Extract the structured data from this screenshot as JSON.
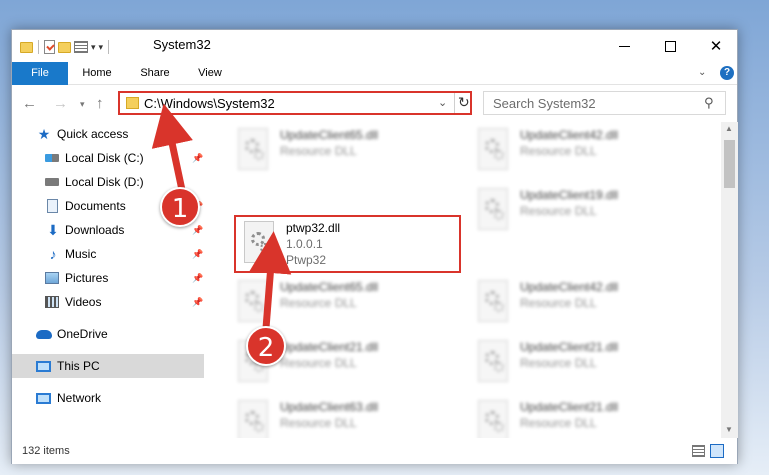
{
  "window": {
    "title": "System32",
    "controls": {
      "minimize": "—",
      "maximize": "☐",
      "close": "✕"
    }
  },
  "ribbon": {
    "tabs": [
      "File",
      "Home",
      "Share",
      "View"
    ],
    "help": "?"
  },
  "address": {
    "path": "C:\\Windows\\System32",
    "search_placeholder": "Search System32"
  },
  "sidebar": {
    "quick_access": {
      "label": "Quick access",
      "icon": "star-icon"
    },
    "items": [
      {
        "label": "Local Disk (C:)",
        "icon": "disk-icon",
        "pinned": true
      },
      {
        "label": "Local Disk (D:)",
        "icon": "disk-icon",
        "pinned": false
      },
      {
        "label": "Documents",
        "icon": "documents-icon",
        "pinned": true
      },
      {
        "label": "Downloads",
        "icon": "downloads-icon",
        "pinned": true
      },
      {
        "label": "Music",
        "icon": "music-icon",
        "pinned": true
      },
      {
        "label": "Pictures",
        "icon": "pictures-icon",
        "pinned": true
      },
      {
        "label": "Videos",
        "icon": "videos-icon",
        "pinned": true
      }
    ],
    "onedrive": "OneDrive",
    "this_pc": "This PC",
    "network": "Network"
  },
  "files": [
    {
      "name": "UpdateClient65.dll",
      "type": "Resource DLL",
      "blurred": true
    },
    {
      "name": "UpdateClient42.dll",
      "type": "Resource DLL",
      "blurred": true
    },
    {
      "name": "ptwp32.dll",
      "version": "1.0.0.1",
      "product": "Ptwp32",
      "highlighted": true
    },
    {
      "name": "UpdateClient19.dll",
      "type": "Resource DLL",
      "blurred": true
    },
    {
      "name": "UpdateClient65.dll",
      "type": "Resource DLL",
      "blurred": true
    },
    {
      "name": "UpdateClient42.dll",
      "type": "Resource DLL",
      "blurred": true
    },
    {
      "name": "UpdateClient21.dll",
      "type": "Resource DLL",
      "blurred": true
    },
    {
      "name": "UpdateClient21.dll",
      "type": "Resource DLL",
      "blurred": true
    },
    {
      "name": "UpdateClient63.dll",
      "type": "Resource DLL",
      "blurred": true
    },
    {
      "name": "UpdateClient21.dll",
      "type": "Resource DLL",
      "blurred": true
    }
  ],
  "status": {
    "item_count": "132 items"
  },
  "annotations": {
    "step1": "1",
    "step2": "2",
    "color": "#d9342b"
  },
  "colors": {
    "accent": "#1979ca",
    "highlight_border": "#d9342b",
    "selected_nav": "#d9d9d9"
  }
}
